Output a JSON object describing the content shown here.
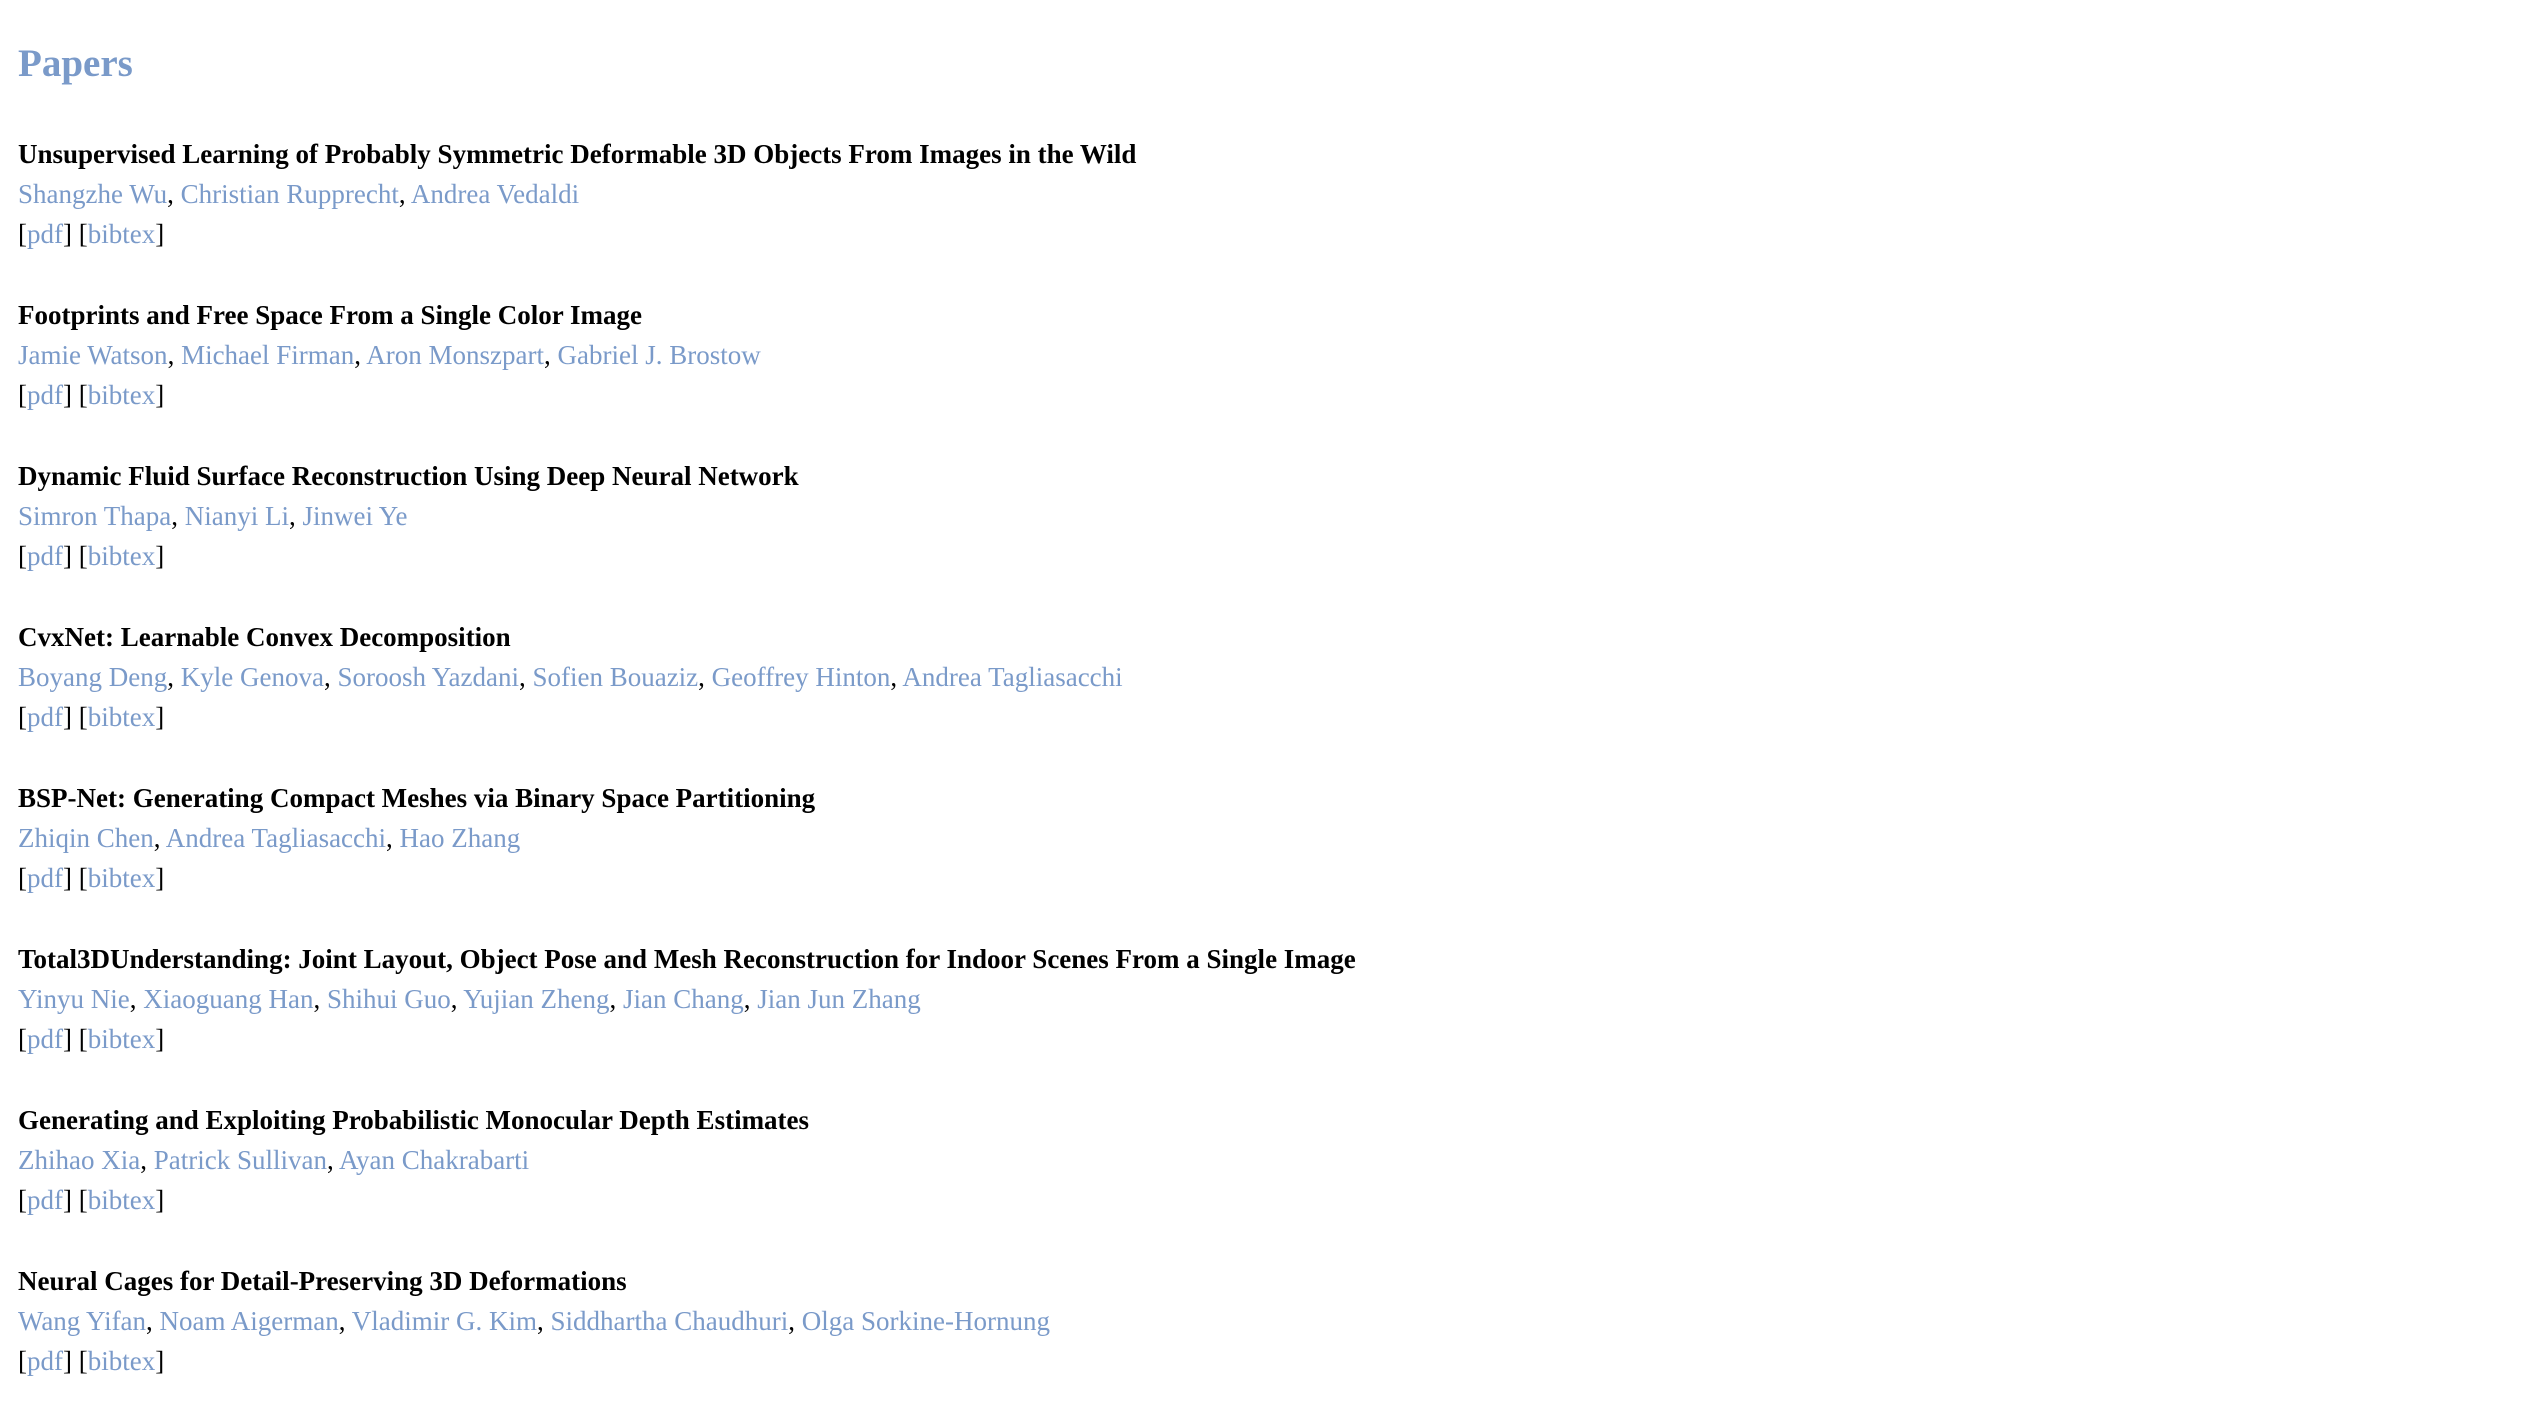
{
  "page": {
    "title": "Papers"
  },
  "labels": {
    "pdf": "pdf",
    "bibtex": "bibtex"
  },
  "papers": [
    {
      "title": "Unsupervised Learning of Probably Symmetric Deformable 3D Objects From Images in the Wild",
      "authors": [
        "Shangzhe Wu",
        "Christian Rupprecht",
        "Andrea Vedaldi"
      ]
    },
    {
      "title": "Footprints and Free Space From a Single Color Image",
      "authors": [
        "Jamie Watson",
        "Michael Firman",
        "Aron Monszpart",
        "Gabriel J. Brostow"
      ]
    },
    {
      "title": "Dynamic Fluid Surface Reconstruction Using Deep Neural Network",
      "authors": [
        "Simron Thapa",
        "Nianyi Li",
        "Jinwei Ye"
      ]
    },
    {
      "title": "CvxNet: Learnable Convex Decomposition",
      "authors": [
        "Boyang Deng",
        "Kyle Genova",
        "Soroosh Yazdani",
        "Sofien Bouaziz",
        "Geoffrey Hinton",
        "Andrea Tagliasacchi"
      ]
    },
    {
      "title": "BSP-Net: Generating Compact Meshes via Binary Space Partitioning",
      "authors": [
        "Zhiqin Chen",
        "Andrea Tagliasacchi",
        "Hao Zhang"
      ]
    },
    {
      "title": "Total3DUnderstanding: Joint Layout, Object Pose and Mesh Reconstruction for Indoor Scenes From a Single Image",
      "authors": [
        "Yinyu Nie",
        "Xiaoguang Han",
        "Shihui Guo",
        "Yujian Zheng",
        "Jian Chang",
        "Jian Jun Zhang"
      ]
    },
    {
      "title": "Generating and Exploiting Probabilistic Monocular Depth Estimates",
      "authors": [
        "Zhihao Xia",
        "Patrick Sullivan",
        "Ayan Chakrabarti"
      ]
    },
    {
      "title": "Neural Cages for Detail-Preserving 3D Deformations",
      "authors": [
        "Wang Yifan",
        "Noam Aigerman",
        "Vladimir G. Kim",
        "Siddhartha Chaudhuri",
        "Olga Sorkine-Hornung"
      ]
    }
  ]
}
